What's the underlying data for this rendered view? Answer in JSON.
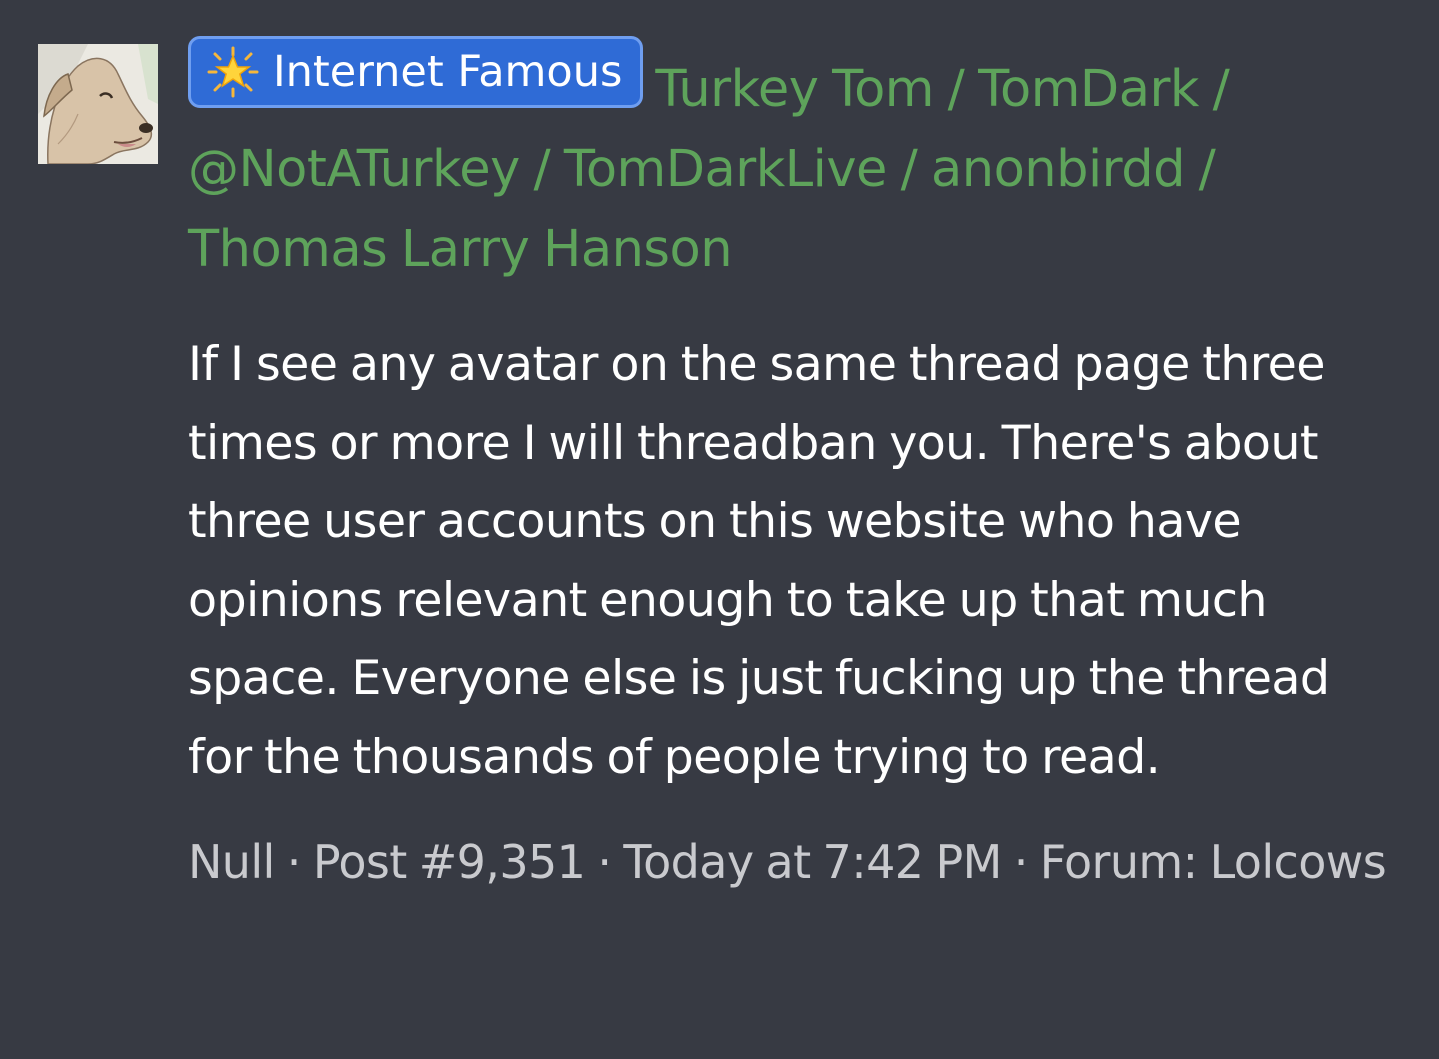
{
  "post": {
    "badge": {
      "icon": "star-icon",
      "label": "Internet Famous",
      "color": "#2f6bd6"
    },
    "author_names": "Turkey Tom / TomDark / @NotATurkey / TomDarkLive / anonbirdd / Thomas Larry Hanson",
    "author_color": "#5ea35b",
    "body": "If I see any avatar on the same thread page three times or more I will threadban you. There's about three user accounts on this website who have opinions relevant enough to take up that much space. Everyone else is just fucking up the thread for the thousands of people trying to read.",
    "meta": {
      "poster": "Null",
      "sep1": "·",
      "post_number": "Post #9,351",
      "sep2": "·",
      "timestamp": "Today at 7:42 PM",
      "sep3": "·",
      "forum_label": "Forum:",
      "forum_name": "Lolcows"
    }
  }
}
